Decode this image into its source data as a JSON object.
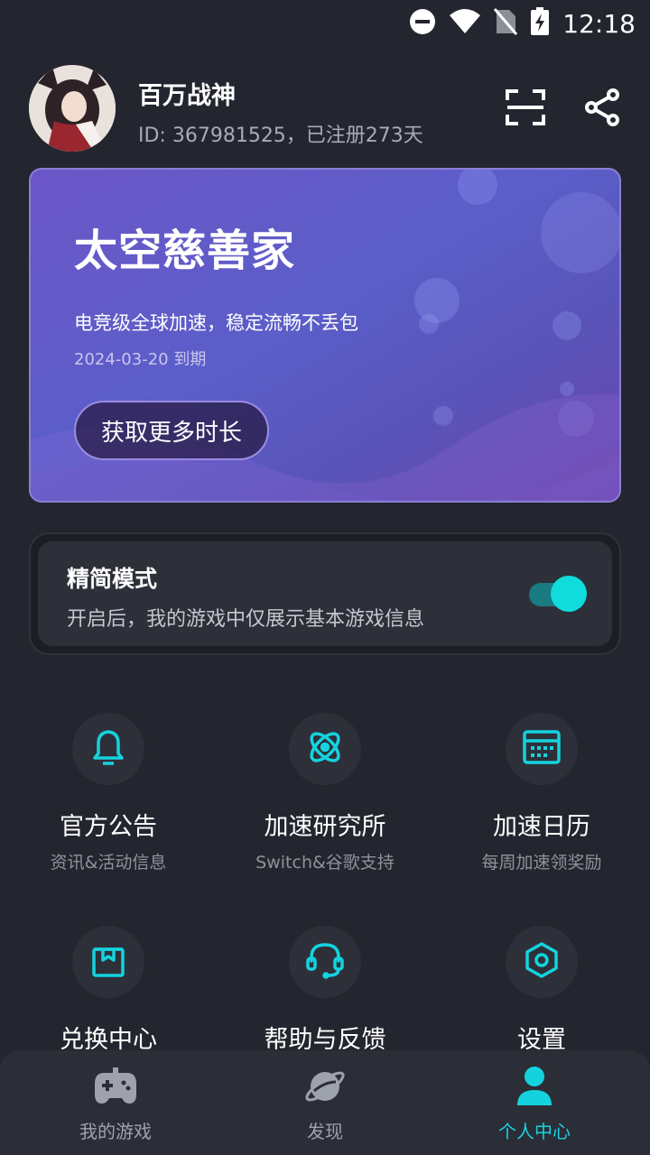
{
  "status_bar": {
    "time": "12:18"
  },
  "header": {
    "username": "百万战神",
    "user_id_text": "ID: 367981525，已注册273天"
  },
  "banner": {
    "title": "太空慈善家",
    "subtitle": "电竞级全球加速，稳定流畅不丢包",
    "expiry": "2024-03-20 到期",
    "button_label": "获取更多时长"
  },
  "simple_mode": {
    "title": "精简模式",
    "description": "开启后，我的游戏中仅展示基本游戏信息",
    "enabled": true
  },
  "grid": [
    {
      "label": "官方公告",
      "sub": "资讯&活动信息",
      "icon": "bell-icon"
    },
    {
      "label": "加速研究所",
      "sub": "Switch&谷歌支持",
      "icon": "atom-icon"
    },
    {
      "label": "加速日历",
      "sub": "每周加速领奖励",
      "icon": "calendar-icon"
    },
    {
      "label": "兑换中心",
      "sub": "",
      "icon": "gift-box-icon"
    },
    {
      "label": "帮助与反馈",
      "sub": "",
      "icon": "headset-icon"
    },
    {
      "label": "设置",
      "sub": "",
      "icon": "hexagon-settings-icon"
    }
  ],
  "bottom_nav": [
    {
      "label": "我的游戏",
      "icon": "gamepad-icon",
      "active": false
    },
    {
      "label": "发现",
      "icon": "planet-icon",
      "active": false
    },
    {
      "label": "个人中心",
      "icon": "person-icon",
      "active": true
    }
  ],
  "colors": {
    "accent": "#14d3df",
    "background": "#23262e",
    "card": "#2d3039"
  }
}
